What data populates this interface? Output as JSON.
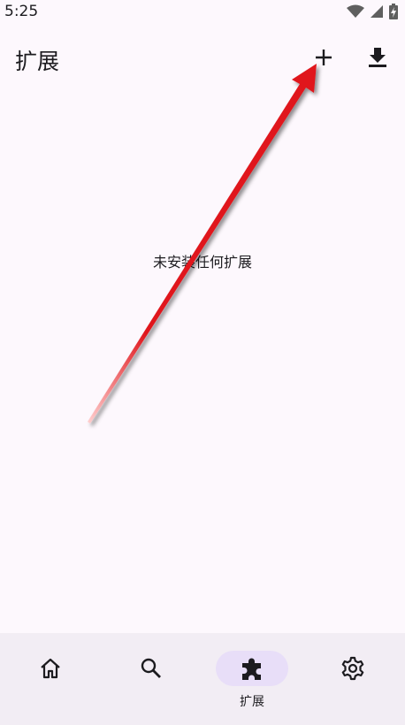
{
  "status_bar": {
    "time": "5:25",
    "icons": [
      "wifi-icon",
      "signal-icon",
      "battery-charging-icon"
    ]
  },
  "app_bar": {
    "title": "扩展",
    "actions": [
      "add-icon",
      "download-icon"
    ]
  },
  "main": {
    "empty_message": "未安装任何扩展"
  },
  "annotation": {
    "type": "arrow",
    "color": "#e0191f",
    "points_to": "add-button"
  },
  "bottom_nav": {
    "items": [
      {
        "icon": "home-icon",
        "label": "",
        "active": false
      },
      {
        "icon": "search-icon",
        "label": "",
        "active": false
      },
      {
        "icon": "puzzle-icon",
        "label": "扩展",
        "active": true
      },
      {
        "icon": "settings-gear-icon",
        "label": "",
        "active": false
      }
    ]
  },
  "colors": {
    "background": "#fdf8fd",
    "nav_background": "#f2edf4",
    "active_indicator": "#e8def8",
    "text": "#1c1b1f"
  }
}
